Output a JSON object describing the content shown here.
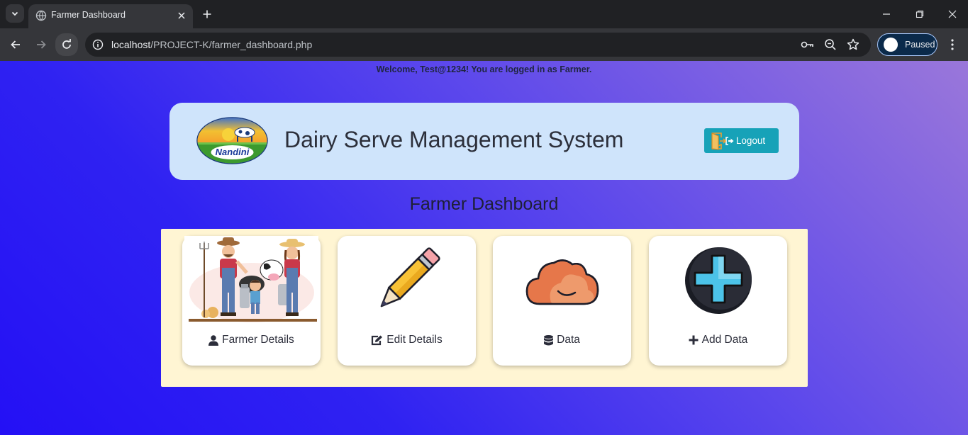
{
  "browser": {
    "tab_title": "Farmer Dashboard",
    "url_host": "localhost",
    "url_path": "/PROJECT-K/farmer_dashboard.php",
    "profile_label": "Paused"
  },
  "page": {
    "welcome": "Welcome, Test@1234! You are logged in as Farmer.",
    "site_title": "Dairy Serve Management System",
    "logo_text": "Nandini",
    "logout_label": "Logout",
    "dashboard_title": "Farmer Dashboard",
    "cards": [
      {
        "label": "Farmer Details",
        "icon": "user-icon",
        "image": "farmer-family-illustration"
      },
      {
        "label": "Edit Details",
        "icon": "edit-icon",
        "image": "pencil-illustration"
      },
      {
        "label": "Data",
        "icon": "database-icon",
        "image": "cloud-illustration"
      },
      {
        "label": "Add Data",
        "icon": "plus-icon",
        "image": "plus-circle-illustration"
      }
    ]
  },
  "colors": {
    "header_card": "#cfe4fb",
    "logout_button": "#17a2b8",
    "cards_panel": "#fff5d3",
    "background_start": "#2410f5",
    "background_end": "#9a77da"
  }
}
